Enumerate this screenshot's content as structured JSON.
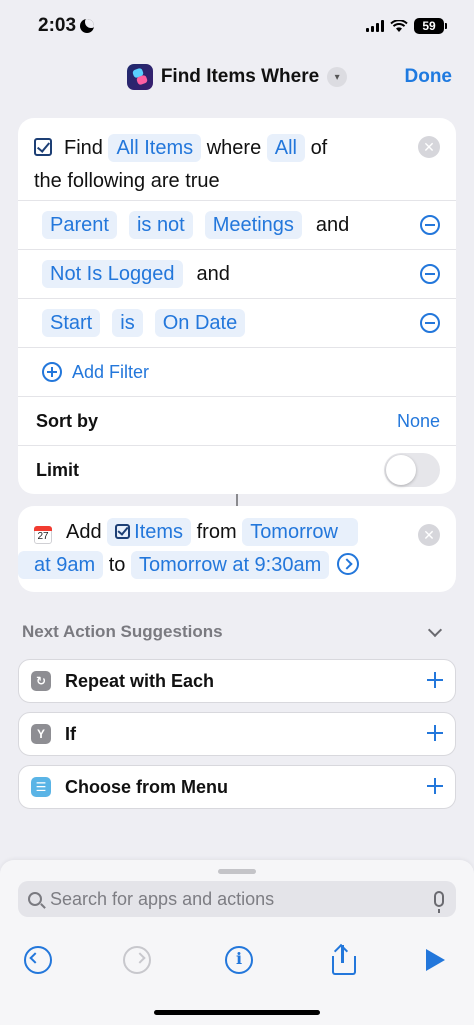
{
  "status_bar": {
    "time": "2:03",
    "battery": "59"
  },
  "nav": {
    "title": "Find Items Where",
    "done_label": "Done"
  },
  "find_action": {
    "find_word": "Find",
    "items_chip": "All Items",
    "where_word": "where",
    "all_chip": "All",
    "of_word": "of",
    "line2": "the following are true",
    "filters": [
      {
        "field": "Parent",
        "operator": "is not",
        "value": "Meetings",
        "joiner": "and"
      },
      {
        "field": "Not Is Logged",
        "joiner": "and"
      },
      {
        "field": "Start",
        "operator": "is",
        "value": "On Date"
      }
    ],
    "add_filter_label": "Add Filter",
    "sort_by_label": "Sort by",
    "sort_by_value": "None",
    "limit_label": "Limit",
    "limit_enabled": false
  },
  "add_action": {
    "calendar_day": "27",
    "add_word": "Add",
    "items_chip": "Items",
    "from_word": "from",
    "from_chip_part1": "Tomorrow",
    "from_chip_part2": "at 9am",
    "to_word": "to",
    "to_chip": "Tomorrow at 9:30am"
  },
  "suggestions": {
    "header": "Next Action Suggestions",
    "items": [
      {
        "label": "Repeat with Each",
        "icon": "repeat-icon",
        "color": "#8e8e93"
      },
      {
        "label": "If",
        "icon": "if-icon",
        "color": "#8e8e93"
      },
      {
        "label": "Choose from Menu",
        "icon": "menu-icon",
        "color": "#5ab4e6"
      }
    ]
  },
  "bottom": {
    "search_placeholder": "Search for apps and actions"
  },
  "colors": {
    "accent": "#2377db",
    "chip_bg": "#e8f0fb",
    "background": "#eeeef3"
  }
}
